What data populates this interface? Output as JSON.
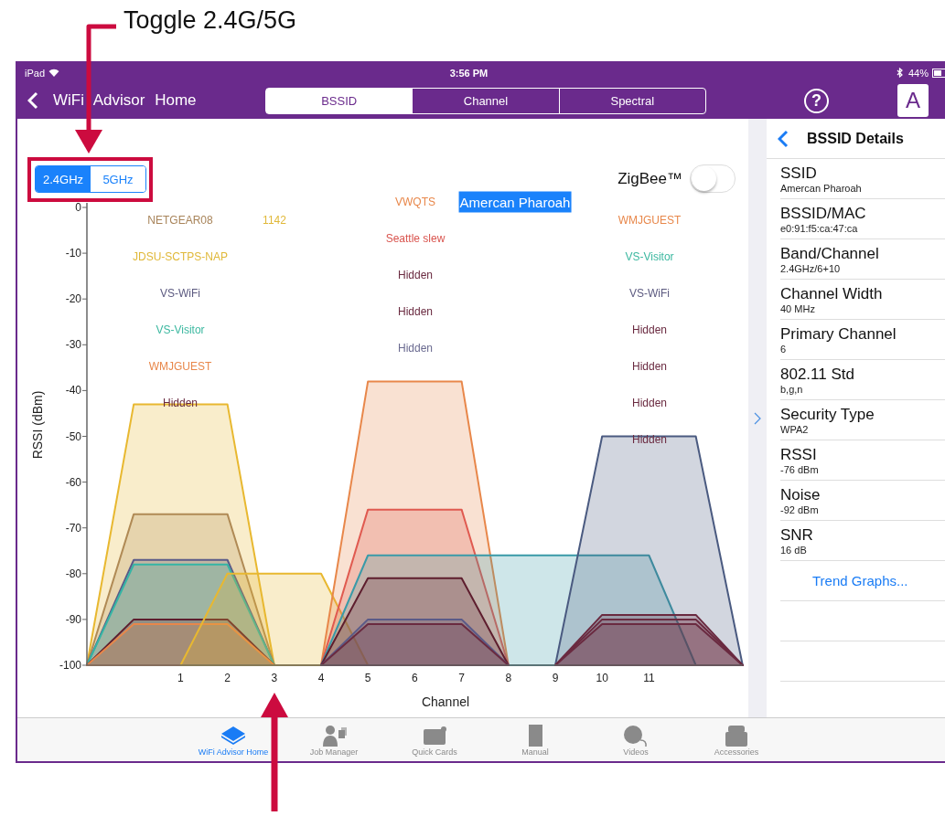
{
  "annotation": {
    "caption": "Toggle 2.4G/5G"
  },
  "status_bar": {
    "carrier": "iPad",
    "time": "3:56 PM",
    "battery": "44%"
  },
  "nav": {
    "back": "WiFi Advisor Home",
    "help": "?",
    "app_icon": "A",
    "segments": [
      {
        "label": "BSSID",
        "selected": true
      },
      {
        "label": "Channel",
        "selected": false
      },
      {
        "label": "Spectral",
        "selected": false
      }
    ]
  },
  "band_toggle": [
    {
      "label": "2.4GHz",
      "selected": true
    },
    {
      "label": "5GHz",
      "selected": false
    }
  ],
  "zigbee": {
    "label": "ZigBee™",
    "on": false
  },
  "ssid_columns": [
    {
      "labels": [
        {
          "text": "NETGEAR08",
          "color": "#a8845a",
          "selected": false
        },
        {
          "text": "JDSU-SCTPS-NAP",
          "color": "#e0b838",
          "selected": false
        },
        {
          "text": "VS-WiFi",
          "color": "#5c5a80",
          "selected": false
        },
        {
          "text": "VS-Visitor",
          "color": "#3cb8a0",
          "selected": false
        },
        {
          "text": "WMJGUEST",
          "color": "#e8874a",
          "selected": false
        },
        {
          "text": "Hidden",
          "color": "#6a2a40",
          "selected": false
        }
      ]
    },
    {
      "labels": [
        {
          "text": "1142",
          "color": "#e0b838",
          "selected": false
        }
      ]
    },
    {
      "labels": [
        {
          "text": "VWQTS",
          "color": "#e8874a",
          "selected": false
        },
        {
          "text": "Seattle slew",
          "color": "#d9544e",
          "selected": false
        },
        {
          "text": "Hidden",
          "color": "#6a2a40",
          "selected": false
        },
        {
          "text": "Hidden",
          "color": "#6a2a40",
          "selected": false
        },
        {
          "text": "Hidden",
          "color": "#6a6a90",
          "selected": false
        }
      ]
    },
    {
      "labels": [
        {
          "text": "Amercan Pharoah",
          "selected": true
        }
      ]
    },
    {
      "labels": [
        {
          "text": "WMJGUEST",
          "color": "#e8874a",
          "selected": false
        },
        {
          "text": "VS-Visitor",
          "color": "#3cb8a0",
          "selected": false
        },
        {
          "text": "VS-WiFi",
          "color": "#5c5a80",
          "selected": false
        },
        {
          "text": "Hidden",
          "color": "#6a2a40",
          "selected": false
        },
        {
          "text": "Hidden",
          "color": "#6a2a40",
          "selected": false
        },
        {
          "text": "Hidden",
          "color": "#6a2a40",
          "selected": false
        },
        {
          "text": "Hidden",
          "color": "#6a2a40",
          "selected": false
        }
      ]
    }
  ],
  "chart": {
    "chart_data": {
      "type": "area",
      "xlabel": "Channel",
      "ylabel": "RSSI (dBm)",
      "x": [
        -1,
        0,
        1,
        2,
        3,
        4,
        5,
        6,
        7,
        8,
        9,
        10,
        11,
        12,
        13
      ],
      "xlim": [
        -1,
        13
      ],
      "ylim": [
        -100,
        0
      ],
      "xticks": [
        1,
        2,
        3,
        4,
        5,
        6,
        7,
        8,
        9,
        10,
        11
      ],
      "yticks": [
        0,
        -10,
        -20,
        -30,
        -40,
        -50,
        -60,
        -70,
        -80,
        -90,
        -100
      ],
      "series": [
        {
          "color": "#e8b830",
          "values": [
            -100,
            -43,
            -43,
            -43,
            -100,
            null,
            null,
            null,
            null,
            null,
            null,
            null,
            null,
            null,
            null
          ]
        },
        {
          "color": "#b08a55",
          "values": [
            -100,
            -67,
            -67,
            -67,
            -100,
            null,
            null,
            null,
            null,
            null,
            null,
            null,
            null,
            null,
            null
          ]
        },
        {
          "color": "#5a5a88",
          "values": [
            -100,
            -77,
            -77,
            -77,
            -100,
            null,
            null,
            null,
            null,
            null,
            null,
            null,
            null,
            null,
            null
          ]
        },
        {
          "color": "#35b5a5",
          "values": [
            -100,
            -78,
            -78,
            -78,
            -100,
            null,
            null,
            null,
            null,
            null,
            null,
            null,
            null,
            null,
            null
          ]
        },
        {
          "color": "#5e1e2e",
          "values": [
            -100,
            -90,
            -90,
            -90,
            -100,
            null,
            null,
            null,
            null,
            null,
            null,
            null,
            null,
            null,
            null
          ]
        },
        {
          "color": "#e8874a",
          "values": [
            -100,
            -91,
            -91,
            -91,
            -100,
            null,
            null,
            null,
            null,
            null,
            null,
            null,
            null,
            null,
            null
          ]
        },
        {
          "color": "#e8b830",
          "values": [
            null,
            null,
            -100,
            -80,
            -80,
            -80,
            -100,
            null,
            null,
            null,
            null,
            null,
            null,
            null,
            null
          ]
        },
        {
          "color": "#e8874a",
          "values": [
            null,
            null,
            null,
            null,
            null,
            -100,
            -38,
            -38,
            -38,
            -100,
            null,
            null,
            null,
            null,
            null
          ]
        },
        {
          "color": "#e05a50",
          "values": [
            null,
            null,
            null,
            null,
            null,
            -100,
            -66,
            -66,
            -66,
            -100,
            null,
            null,
            null,
            null,
            null
          ]
        },
        {
          "color": "#3a9aa8",
          "values": [
            null,
            null,
            null,
            null,
            null,
            -100,
            -76,
            -76,
            -76,
            -76,
            -76,
            -76,
            -76,
            -100,
            null
          ]
        },
        {
          "color": "#5e1e2e",
          "values": [
            null,
            null,
            null,
            null,
            null,
            -100,
            -81,
            -81,
            -81,
            -100,
            null,
            null,
            null,
            null,
            null
          ]
        },
        {
          "color": "#5a5a88",
          "values": [
            null,
            null,
            null,
            null,
            null,
            -100,
            -90,
            -90,
            -90,
            -100,
            null,
            null,
            null,
            null,
            null
          ]
        },
        {
          "color": "#6a2a40",
          "values": [
            null,
            null,
            null,
            null,
            null,
            -100,
            -91,
            -91,
            -91,
            -100,
            null,
            null,
            null,
            null,
            null
          ]
        },
        {
          "color": "#4a5a80",
          "values": [
            null,
            null,
            null,
            null,
            null,
            null,
            null,
            null,
            null,
            null,
            -100,
            -50,
            -50,
            -50,
            -100
          ]
        },
        {
          "color": "#6a2a40",
          "values": [
            null,
            null,
            null,
            null,
            null,
            null,
            null,
            null,
            null,
            null,
            -100,
            -89,
            -89,
            -89,
            -100
          ]
        },
        {
          "color": "#6a2a40",
          "values": [
            null,
            null,
            null,
            null,
            null,
            null,
            null,
            null,
            null,
            null,
            -100,
            -90,
            -90,
            -90,
            -100
          ]
        },
        {
          "color": "#6a2a40",
          "values": [
            null,
            null,
            null,
            null,
            null,
            null,
            null,
            null,
            null,
            null,
            -100,
            -91,
            -91,
            -91,
            -100
          ]
        }
      ]
    }
  },
  "details": {
    "title": "BSSID Details",
    "link": "Trend Graphs...",
    "rows": [
      {
        "label": "SSID",
        "value": "Amercan Pharoah"
      },
      {
        "label": "BSSID/MAC",
        "value": "e0:91:f5:ca:47:ca"
      },
      {
        "label": "Band/Channel",
        "value": "2.4GHz/6+10"
      },
      {
        "label": "Channel Width",
        "value": "40 MHz"
      },
      {
        "label": "Primary Channel",
        "value": "6"
      },
      {
        "label": "802.11 Std",
        "value": "b,g,n"
      },
      {
        "label": "Security Type",
        "value": "WPA2"
      },
      {
        "label": "RSSI",
        "value": "-76 dBm"
      },
      {
        "label": "Noise",
        "value": "-92 dBm"
      },
      {
        "label": "SNR",
        "value": "16 dB"
      }
    ]
  },
  "tab_bar": [
    {
      "label": "WiFi Advisor Home",
      "selected": true
    },
    {
      "label": "Job Manager",
      "selected": false
    },
    {
      "label": "Quick Cards",
      "selected": false
    },
    {
      "label": "Manual",
      "selected": false
    },
    {
      "label": "Videos",
      "selected": false
    },
    {
      "label": "Accessories",
      "selected": false
    }
  ]
}
